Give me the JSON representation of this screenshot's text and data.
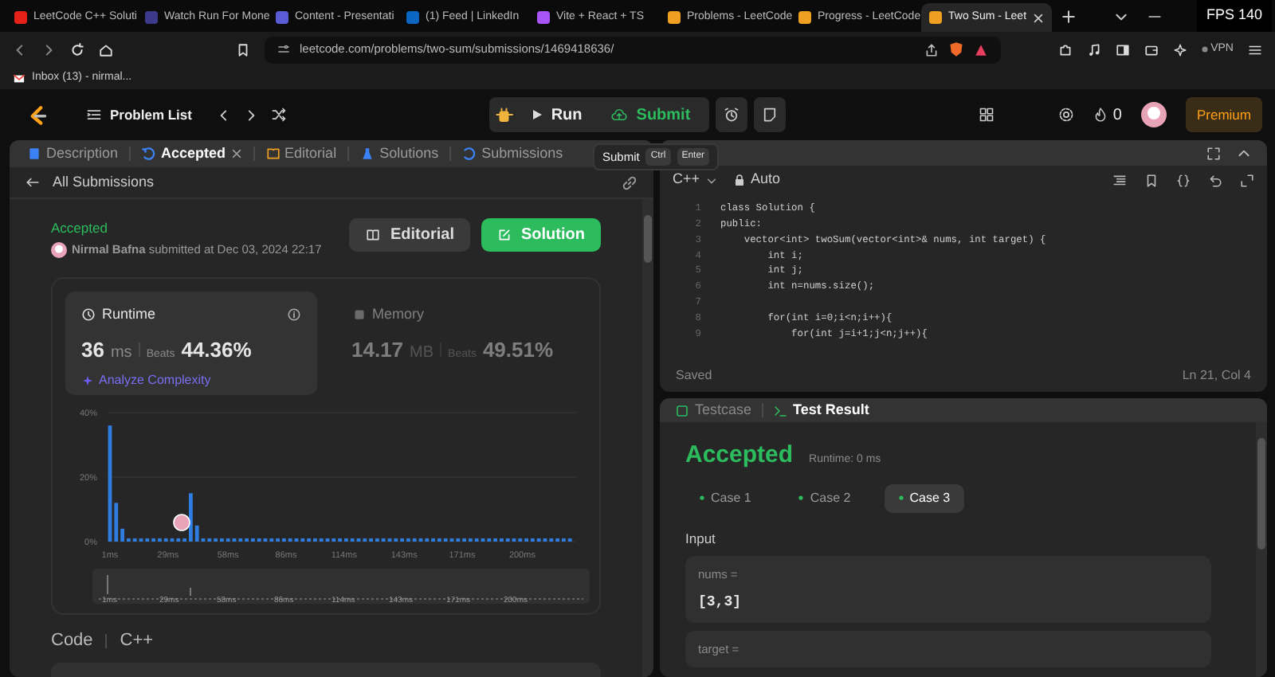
{
  "browser": {
    "tabs": [
      {
        "title": "LeetCode C++ Soluti",
        "color": "#e62117",
        "selected": false
      },
      {
        "title": "Watch Run For Mone",
        "color": "#3d3a8c",
        "selected": false
      },
      {
        "title": "Content - Presentati",
        "color": "#5b5bd6",
        "selected": false
      },
      {
        "title": "(1) Feed | LinkedIn",
        "color": "#0a66c2",
        "selected": false
      },
      {
        "title": "Vite + React + TS",
        "color": "#a855f7",
        "selected": false
      },
      {
        "title": "Problems - LeetCode",
        "color": "#f0a020",
        "selected": false
      },
      {
        "title": "Progress - LeetCode",
        "color": "#f0a020",
        "selected": false
      },
      {
        "title": "Two Sum - Leet",
        "color": "#f0a020",
        "selected": true
      }
    ],
    "fps": "FPS 140",
    "address": "leetcode.com/problems/two-sum/submissions/1469418636/",
    "vpn": "VPN",
    "bookmarks": [
      "Inbox (13) - nirmal..."
    ]
  },
  "toolbar": {
    "problem_list": "Problem List",
    "run": "Run",
    "submit": "Submit",
    "streak": "0",
    "premium": "Premium"
  },
  "tooltip": {
    "label": "Submit",
    "keys": [
      "Ctrl",
      "Enter"
    ]
  },
  "left_panel": {
    "tabs": [
      {
        "label": "Description",
        "selected": false,
        "closable": false
      },
      {
        "label": "Accepted",
        "selected": true,
        "closable": true
      },
      {
        "label": "Editorial",
        "selected": false,
        "closable": false
      },
      {
        "label": "Solutions",
        "selected": false,
        "closable": false
      },
      {
        "label": "Submissions",
        "selected": false,
        "closable": false
      }
    ],
    "back_link": "All Submissions",
    "status": "Accepted",
    "submitted": "**Nirmal Bafna** submitted at Dec 03, 2024 22:17",
    "buttons": [
      "Editorial",
      "Solution"
    ],
    "stats": [
      {
        "label": "Runtime",
        "value": "36",
        "unit": "ms",
        "beats_label": "Beats",
        "beats": "44.36%",
        "selected": true
      },
      {
        "label": "Memory",
        "value": "14.17",
        "unit": "MB",
        "beats_label": "Beats",
        "beats": "49.51%",
        "selected": false
      }
    ],
    "analyze": "Analyze Complexity",
    "chart_data": {
      "type": "bar",
      "x": [
        1,
        4,
        7,
        10,
        13,
        16,
        19,
        22,
        25,
        28,
        31,
        34,
        37,
        40,
        43,
        46,
        49,
        52,
        55,
        58,
        61,
        64,
        67,
        70,
        73,
        76,
        79,
        82,
        85,
        88,
        91,
        94,
        97,
        100,
        103,
        106,
        109,
        112,
        115,
        118,
        121,
        124,
        127,
        130,
        133,
        136,
        139,
        142,
        145,
        148,
        151,
        154,
        157,
        160,
        163,
        166,
        169,
        172,
        175,
        178,
        181,
        184,
        187,
        190,
        193,
        196,
        199,
        202,
        205,
        208,
        211,
        214,
        217,
        220,
        223
      ],
      "series": [
        {
          "color": "#2f7de1",
          "values": [
            36,
            12,
            4,
            1,
            1,
            1,
            1,
            1,
            1,
            1,
            1,
            1,
            1,
            15,
            5,
            1,
            1,
            1,
            1,
            1,
            1,
            1,
            1,
            1,
            1,
            1,
            1,
            1,
            1,
            1,
            1,
            1,
            1,
            1,
            1,
            1,
            1,
            1,
            1,
            1,
            1,
            1,
            1,
            1,
            1,
            1,
            1,
            1,
            1,
            1,
            1,
            1,
            1,
            1,
            1,
            1,
            1,
            1,
            1,
            1,
            1,
            1,
            1,
            1,
            1,
            1,
            1,
            1,
            1,
            1,
            1,
            1,
            1,
            1,
            1
          ]
        }
      ],
      "xlim": [
        0,
        226
      ],
      "ylim": [
        0,
        40
      ],
      "yticks": [
        {
          "value": 0,
          "label": "0%"
        },
        {
          "value": 20,
          "label": "20%"
        },
        {
          "value": 40,
          "label": "40%"
        }
      ],
      "xticks": [
        {
          "value": 1,
          "label": "1ms"
        },
        {
          "value": 29,
          "label": "29ms"
        },
        {
          "value": 58,
          "label": "58ms"
        },
        {
          "value": 86,
          "label": "86ms"
        },
        {
          "value": 114,
          "label": "114ms"
        },
        {
          "value": 143,
          "label": "143ms"
        },
        {
          "value": 171,
          "label": "171ms"
        },
        {
          "value": 200,
          "label": "200ms"
        }
      ]
    },
    "overview_labels": [
      "1ms",
      "29ms",
      "58ms",
      "86ms",
      "114ms",
      "143ms",
      "171ms",
      "200ms"
    ],
    "code_label": "Code",
    "language": "C++"
  },
  "editor": {
    "language": "C++",
    "mode": "Auto",
    "lines": [
      {
        "number": "1",
        "text": "class Solution {"
      },
      {
        "number": "2",
        "text": "public:"
      },
      {
        "number": "3",
        "text": "    vector<int> twoSum(vector<int>& nums, int target) {"
      },
      {
        "number": "4",
        "text": "        int i;"
      },
      {
        "number": "5",
        "text": "        int j;"
      },
      {
        "number": "6",
        "text": "        int n=nums.size();"
      },
      {
        "number": "7"
      },
      {
        "number": "8",
        "text": "        for(int i=0;i<n;i++){"
      },
      {
        "number": "9",
        "text": "            for(int j=i+1;j<n;j++){"
      }
    ],
    "status": "Saved",
    "position": "Ln 21, Col 4"
  },
  "result": {
    "tabs": [
      {
        "label": "Testcase",
        "selected": false
      },
      {
        "label": "Test Result",
        "selected": true
      }
    ],
    "verdict": "Accepted",
    "runtime": "Runtime: 0 ms",
    "cases": [
      {
        "label": "Case 1",
        "selected": false
      },
      {
        "label": "Case 2",
        "selected": false
      },
      {
        "label": "Case 3",
        "selected": true
      }
    ],
    "input_label": "Input",
    "inputs": [
      {
        "name": "nums =",
        "value": "[3,3]"
      },
      {
        "name": "target ="
      }
    ]
  }
}
